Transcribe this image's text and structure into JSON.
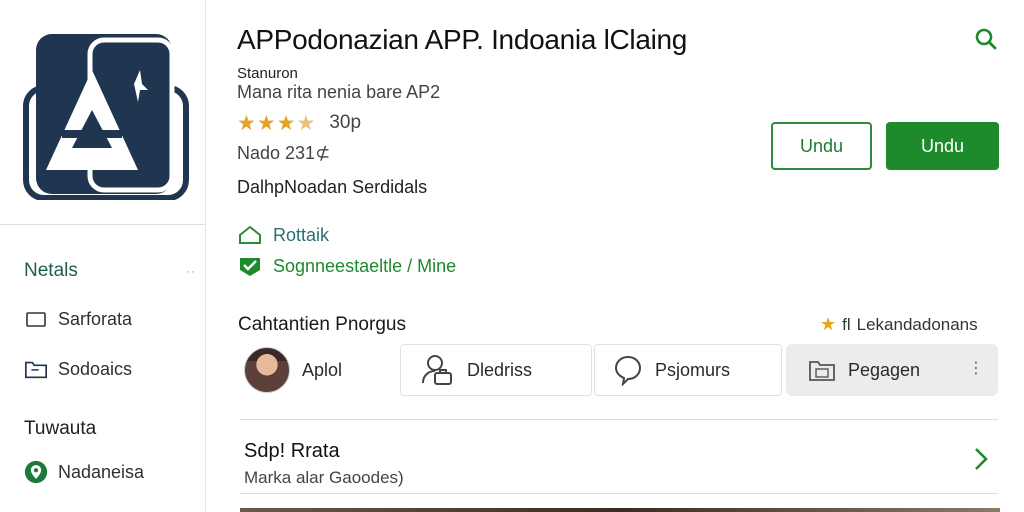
{
  "colors": {
    "accent_green": "#1d8a2c",
    "icon_navy": "#1f3550",
    "star": "#e8a31f"
  },
  "app": {
    "title": "APPodonazian APP. Indoania lClaing",
    "developer": "Stanuron",
    "subtitle": "Mana rita nenia bare AP2",
    "rating_text": "30p",
    "stars": 3.5,
    "version": "Nado 231⊄",
    "tagline": "DalhpNoadan Serdidals"
  },
  "buttons": {
    "outline_label": "Undu",
    "primary_label": "Undu"
  },
  "features": [
    {
      "icon": "home-outline-icon",
      "label": "Rottaik"
    },
    {
      "icon": "check-badge-icon",
      "label": "Sognneestaeltle / Mine"
    }
  ],
  "sidebar": {
    "heading1": "Netals",
    "items": [
      {
        "icon": "square-icon",
        "label": "Sarforata"
      },
      {
        "icon": "folder-icon",
        "label": "Sodoaics"
      }
    ],
    "heading2": "Tuwauta",
    "items2": [
      {
        "icon": "shield-pin-icon",
        "label": "Nadaneisa"
      }
    ]
  },
  "section": {
    "title": "Cahtantien Pnorgus",
    "right_label": "Lekandadonans",
    "right_prefix": "fl",
    "tabs": [
      {
        "icon": "avatar",
        "label": "Aplol"
      },
      {
        "icon": "person-briefcase-icon",
        "label": "Dledriss"
      },
      {
        "icon": "chat-bubble-icon",
        "label": "Psjomurs"
      },
      {
        "icon": "folder-calendar-icon",
        "label": "Pegagen"
      }
    ]
  },
  "list_row": {
    "title": "Sdp! Rrata",
    "subtitle": "Marka alar Gaoodes)"
  }
}
